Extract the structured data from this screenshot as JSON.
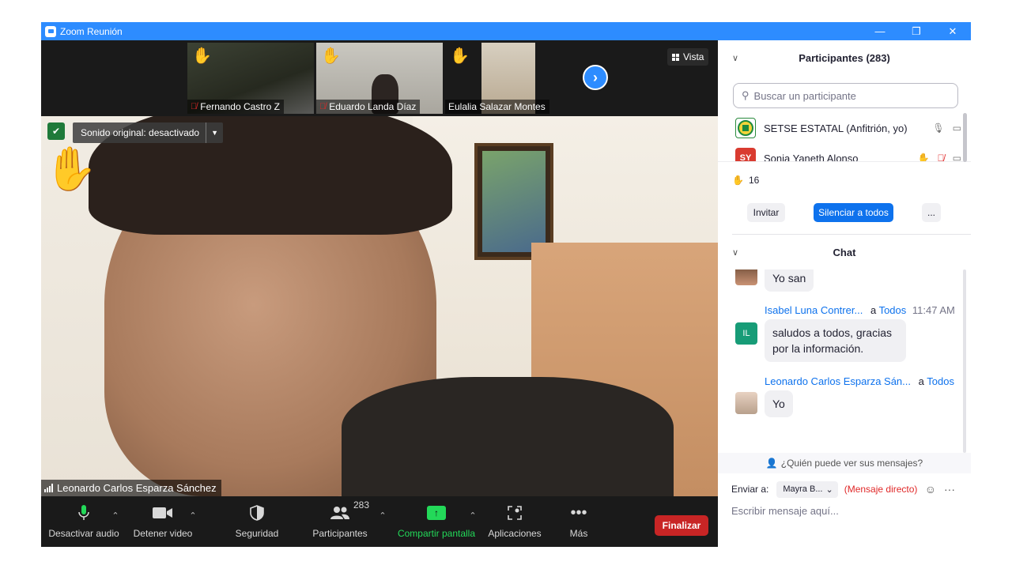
{
  "window": {
    "title": "Zoom Reunión",
    "minimize_glyph": "—",
    "restore_glyph": "❐",
    "close_glyph": "✕"
  },
  "gallery": {
    "thumbnails": [
      {
        "name": "Fernando Castro Z",
        "muted": true,
        "hand_raised": true
      },
      {
        "name": "Eduardo Landa Díaz",
        "muted": true,
        "hand_raised": true
      },
      {
        "name": "Eulalia Salazar Montes",
        "muted": false,
        "hand_raised": true
      }
    ],
    "next_page_glyph": "›",
    "view_button": "Vista"
  },
  "main_video": {
    "sound_original": "Sonido original: desactivado",
    "speaker_name": "Leonardo Carlos Esparza Sánchez"
  },
  "toolbar": {
    "mute_audio": "Desactivar audio",
    "stop_video": "Detener video",
    "security": "Seguridad",
    "participants": "Participantes",
    "participants_count": "283",
    "share_screen": "Compartir pantalla",
    "apps": "Aplicaciones",
    "more": "Más",
    "end": "Finalizar",
    "accent_share": "#23d959",
    "accent_end": "#c82525"
  },
  "participants_panel": {
    "header": "Participantes (283)",
    "search_placeholder": "Buscar un participante",
    "rows": [
      {
        "name": "SETSE ESTATAL (Anfitrión, yo)",
        "avatar_initials": "",
        "avatar_color": "#1d8a3e"
      },
      {
        "name": "Sonia Yaneth Alonso",
        "avatar_initials": "SY",
        "avatar_color": "#d93b30"
      }
    ],
    "raised_hands_count": "16",
    "invite": "Invitar",
    "mute_all": "Silenciar a todos",
    "more": "..."
  },
  "chat_panel": {
    "header": "Chat",
    "messages": [
      {
        "sender": "",
        "to": "",
        "target": "",
        "time": "",
        "text": "Yo san",
        "avatar_initials": ""
      },
      {
        "sender": "Isabel Luna Contrer...",
        "to": "a",
        "target": "Todos",
        "time": "11:47 AM",
        "text": "saludos a todos, gracias por la información.",
        "avatar_initials": "IL"
      },
      {
        "sender": "Leonardo Carlos Esparza Sán...",
        "to": "a",
        "target": "Todos",
        "time": "",
        "text": "Yo",
        "avatar_initials": ""
      }
    ],
    "who_can_see": "¿Quién puede ver sus mensajes?",
    "send_to_label": "Enviar a:",
    "recipient": "Mayra B...",
    "direct_message": "(Mensaje directo)",
    "compose_placeholder": "Escribir mensaje aquí..."
  },
  "colors": {
    "titlebar": "#2d8cff",
    "link_blue": "#0e72ed",
    "raised_hand": "#f5c338"
  }
}
